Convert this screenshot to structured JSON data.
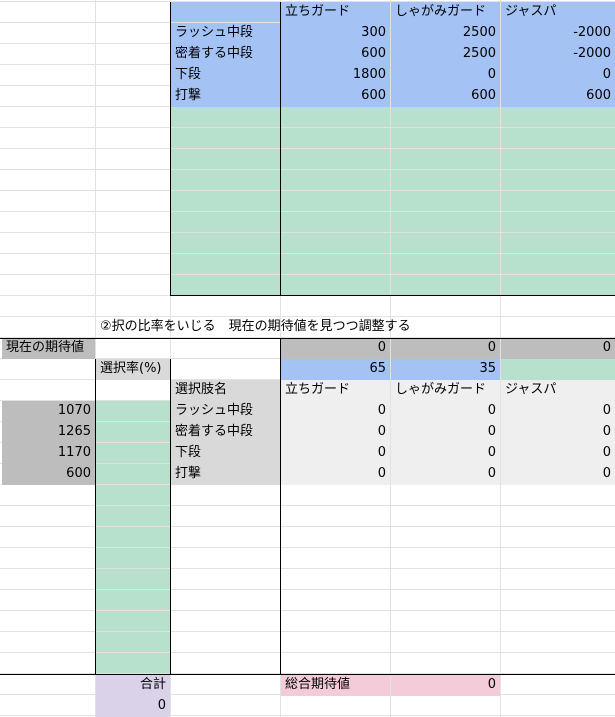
{
  "top_table": {
    "headers": [
      "立ちガード",
      "しゃがみガード",
      "ジャスパ"
    ],
    "rows": [
      {
        "label": "ラッシュ中段",
        "values": [
          "300",
          "2500",
          "-2000"
        ]
      },
      {
        "label": "密着する中段",
        "values": [
          "600",
          "2500",
          "-2000"
        ]
      },
      {
        "label": "下段",
        "values": [
          "1800",
          "0",
          "0"
        ]
      },
      {
        "label": "打撃",
        "values": [
          "600",
          "600",
          "600"
        ]
      }
    ]
  },
  "note": "②択の比率をいじる　現在の期待値を見つつ調整する",
  "expected_row": {
    "label": "現在の期待値",
    "values": [
      "0",
      "0",
      "0"
    ]
  },
  "ratio_row": {
    "label": "選択率(%)",
    "values": [
      "65",
      "35"
    ]
  },
  "bottom_table": {
    "header_label": "選択肢名",
    "headers": [
      "立ちガード",
      "しゃがみガード",
      "ジャスパ"
    ],
    "rows": [
      {
        "current": "1070",
        "label": "ラッシュ中段",
        "values": [
          "0",
          "0",
          "0"
        ]
      },
      {
        "current": "1265",
        "label": "密着する中段",
        "values": [
          "0",
          "0",
          "0"
        ]
      },
      {
        "current": "1170",
        "label": "下段",
        "values": [
          "0",
          "0",
          "0"
        ]
      },
      {
        "current": "600",
        "label": "打撃",
        "values": [
          "0",
          "0",
          "0"
        ]
      }
    ]
  },
  "total": {
    "label": "合計",
    "value": "0"
  },
  "overall": {
    "label": "総合期待値",
    "value": "0"
  },
  "colors": {
    "blue": "#a4c2f4",
    "green": "#b7e1cd",
    "gray": "#bdbdbd",
    "light_gray": "#d9d9d9",
    "purple": "#d9d2e9",
    "pink": "#f4ccd9"
  }
}
